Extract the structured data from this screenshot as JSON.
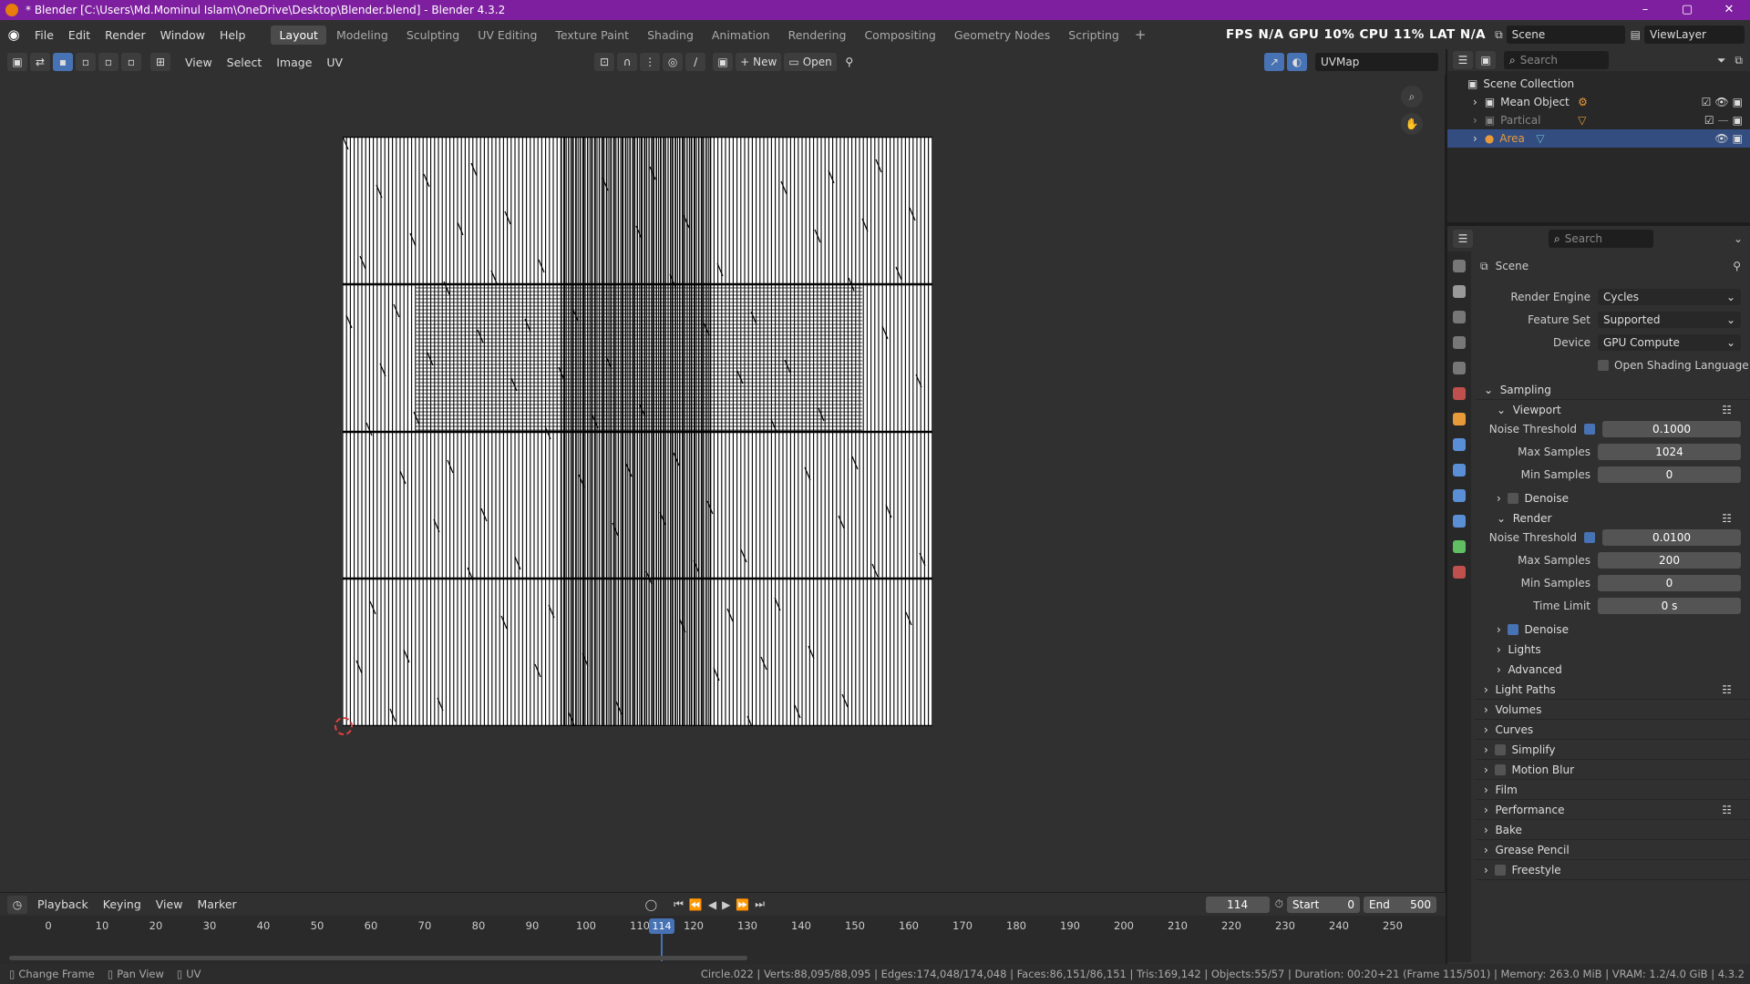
{
  "titlebar": {
    "title": "* Blender [C:\\Users\\Md.Mominul Islam\\OneDrive\\Desktop\\Blender.blend] - Blender 4.3.2",
    "min": "–",
    "max": "▢",
    "close": "✕"
  },
  "menu": {
    "items": [
      "File",
      "Edit",
      "Render",
      "Window",
      "Help"
    ]
  },
  "workspaces": [
    "Layout",
    "Modeling",
    "Sculpting",
    "UV Editing",
    "Texture Paint",
    "Shading",
    "Animation",
    "Rendering",
    "Compositing",
    "Geometry Nodes",
    "Scripting"
  ],
  "active_workspace": "Layout",
  "stats_overlay": "FPS N/A GPU 10% CPU 11% LAT N/A",
  "scene_name": "Scene",
  "view_layer": "ViewLayer",
  "uv_header": {
    "view": "View",
    "select": "Select",
    "image": "Image",
    "uv": "UV",
    "new": "New",
    "open": "Open",
    "uvmap": "UVMap"
  },
  "outliner": {
    "search_placeholder": "Search",
    "collection": "Scene Collection",
    "items": [
      {
        "name": "Mean Object"
      },
      {
        "name": "Partical"
      },
      {
        "name": "Area"
      }
    ]
  },
  "properties": {
    "search_placeholder": "Search",
    "context": "Scene",
    "render_engine_label": "Render Engine",
    "render_engine": "Cycles",
    "feature_set_label": "Feature Set",
    "feature_set": "Supported",
    "device_label": "Device",
    "device": "GPU Compute",
    "osl_label": "Open Shading Language",
    "sampling": "Sampling",
    "viewport": "Viewport",
    "noise_threshold_label": "Noise Threshold",
    "vp_noise_threshold": "0.1000",
    "max_samples_label": "Max Samples",
    "vp_max_samples": "1024",
    "min_samples_label": "Min Samples",
    "vp_min_samples": "0",
    "denoise_label": "Denoise",
    "render": "Render",
    "r_noise_threshold": "0.0100",
    "r_max_samples": "200",
    "r_min_samples": "0",
    "time_limit_label": "Time Limit",
    "r_time_limit": "0 s",
    "lights": "Lights",
    "advanced": "Advanced",
    "panels": [
      "Light Paths",
      "Volumes",
      "Curves",
      "Simplify",
      "Motion Blur",
      "Film",
      "Performance",
      "Bake",
      "Grease Pencil",
      "Freestyle"
    ]
  },
  "timeline": {
    "playback": "Playback",
    "keying": "Keying",
    "view": "View",
    "marker": "Marker",
    "current_frame": "114",
    "start_label": "Start",
    "start": "0",
    "end_label": "End",
    "end": "500",
    "ticks": [
      "0",
      "10",
      "20",
      "30",
      "40",
      "50",
      "60",
      "70",
      "80",
      "90",
      "100",
      "110",
      "120",
      "130",
      "140",
      "150",
      "160",
      "170",
      "180",
      "190",
      "200",
      "210",
      "220",
      "230",
      "240",
      "250"
    ]
  },
  "statusbar": {
    "change_frame": "Change Frame",
    "pan_view": "Pan View",
    "uv": "UV",
    "info": "Circle.022 | Verts:88,095/88,095 | Edges:174,048/174,048 | Faces:86,151/86,151 | Tris:169,142 | Objects:55/57 | Duration: 00:20+21 (Frame 115/501) | Memory: 263.0 MiB | VRAM: 1.2/4.0 GiB | 4.3.2"
  }
}
